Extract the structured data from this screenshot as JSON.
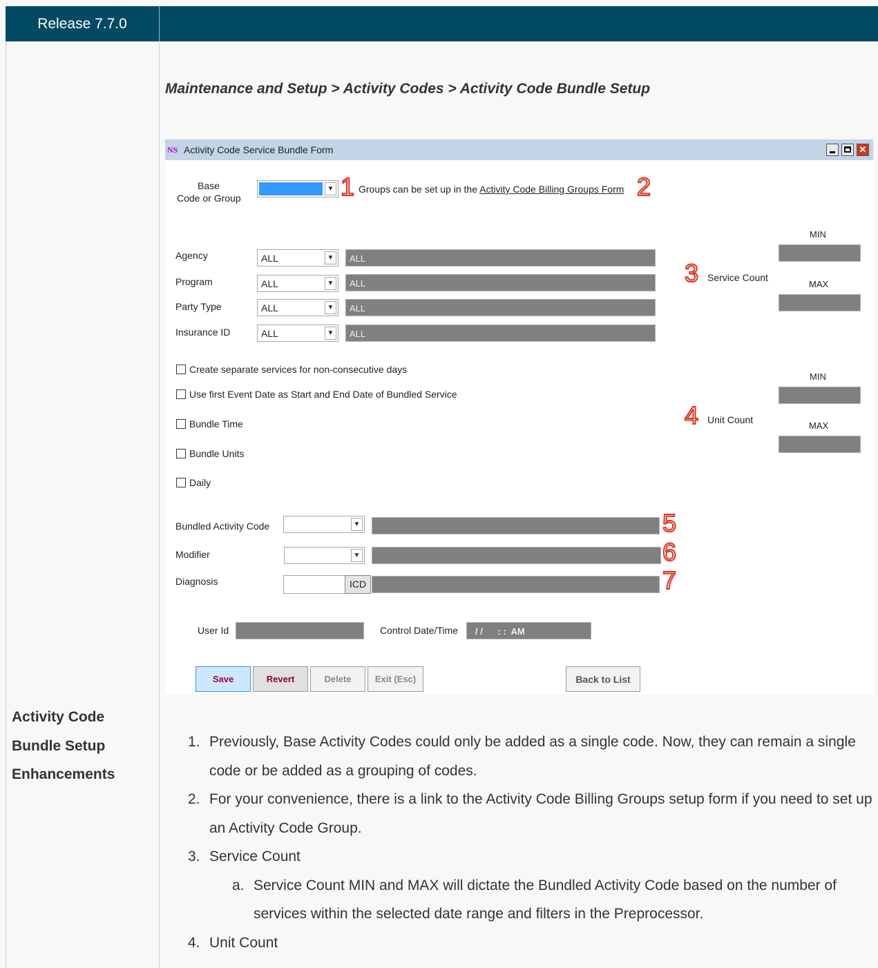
{
  "header": {
    "release": "Release 7.7.0"
  },
  "breadcrumb": "Maintenance and Setup > Activity Codes > Activity Code Bundle Setup",
  "window": {
    "logo": "NS",
    "title": "Activity Code Service Bundle Form",
    "close_glyph": "✕"
  },
  "form": {
    "base_label_line1": "Base",
    "base_label_line2": "Code or Group",
    "groups_text": "Groups can be set up in the",
    "groups_link": "Activity Code Billing Groups Form",
    "filters": [
      {
        "label": "Agency",
        "value": "ALL",
        "desc": "ALL"
      },
      {
        "label": "Program",
        "value": "ALL",
        "desc": "ALL"
      },
      {
        "label": "Party Type",
        "value": "ALL",
        "desc": "ALL"
      },
      {
        "label": "Insurance ID",
        "value": "ALL",
        "desc": "ALL"
      }
    ],
    "service_count": "Service Count",
    "unit_count": "Unit Count",
    "min": "MIN",
    "max": "MAX",
    "checkboxes": [
      "Create separate services for non-consecutive days",
      "Use first Event Date as Start and End Date of Bundled Service",
      "Bundle Time",
      "Bundle Units",
      "Daily"
    ],
    "bundled_activity_code": "Bundled Activity Code",
    "modifier": "Modifier",
    "diagnosis": "Diagnosis",
    "icd": "ICD",
    "user_id": "User Id",
    "control_datetime": "Control Date/Time",
    "control_datetime_value": "/ /      : :  AM",
    "buttons": {
      "save": "Save",
      "revert": "Revert",
      "delete": "Delete",
      "exit": "Exit (Esc)",
      "back": "Back to List"
    }
  },
  "callouts": [
    "1",
    "2",
    "3",
    "4",
    "5",
    "6",
    "7"
  ],
  "side_label": [
    "Activity Code",
    "Bundle Setup",
    "Enhancements"
  ],
  "notes": [
    {
      "n": "1.",
      "text": "Previously, Base Activity Codes could only be added as a single code. Now, they can remain a single code or be added as a grouping of codes."
    },
    {
      "n": "2.",
      "text": "For your convenience, there is a link to the Activity Code Billing Groups setup form if you need to set up an Activity Code Group."
    },
    {
      "n": "3.",
      "text": "Service Count"
    },
    {
      "n": "a.",
      "text": "Service Count MIN and MAX will dictate the Bundled Activity Code based on the number of services within the selected date range and filters in the Preprocessor."
    },
    {
      "n": "4.",
      "text": "Unit Count"
    }
  ],
  "colors": {
    "header_bg": "#004a63",
    "titlebar": "#c2d4e6",
    "field_gray": "#808080",
    "selected_blue": "#3399ff",
    "callout_red": "#e0301e"
  }
}
